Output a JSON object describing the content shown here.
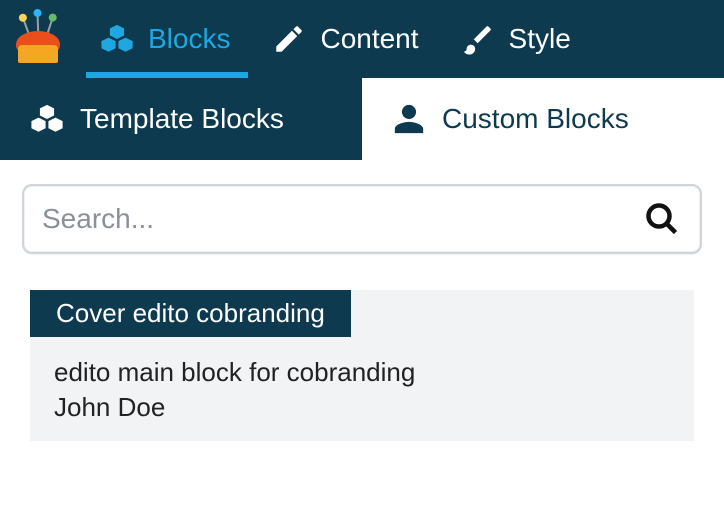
{
  "nav": {
    "blocks_label": "Blocks",
    "content_label": "Content",
    "style_label": "Style"
  },
  "subnav": {
    "template_label": "Template Blocks",
    "custom_label": "Custom Blocks"
  },
  "search": {
    "placeholder": "Search...",
    "value": ""
  },
  "items": [
    {
      "title": "Cover edito cobranding",
      "description": "edito main block for cobranding",
      "author": "John Doe"
    }
  ]
}
